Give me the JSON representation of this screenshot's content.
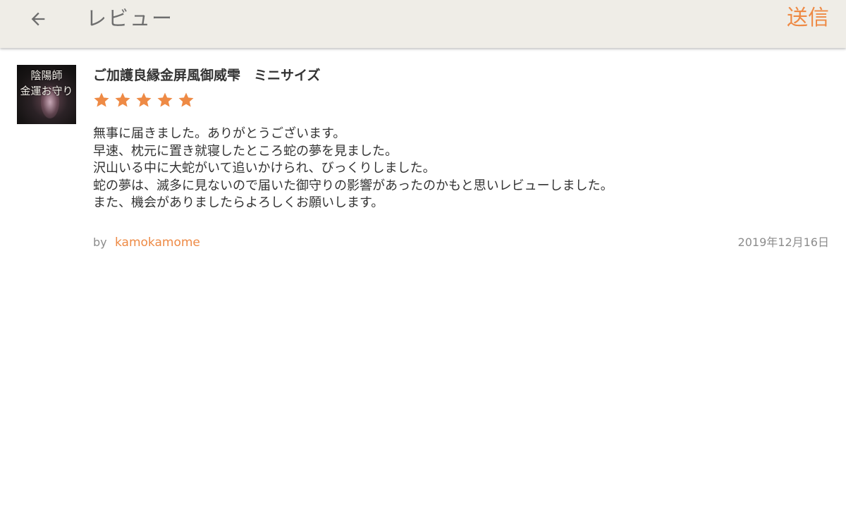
{
  "appbar": {
    "title": "レビュー",
    "send_label": "送信",
    "back_icon": "arrow-left-icon",
    "accent_color": "#ee8a45",
    "background_color": "#efede7"
  },
  "review": {
    "thumbnail": {
      "line1": "陰陽師",
      "line2": "金運お守り"
    },
    "product_title": "ご加護良縁金屏風御威雫　ミニサイズ",
    "rating": 5,
    "rating_max": 5,
    "star_color": "#ee8a45",
    "body_lines": [
      "無事に届きました。ありがとうございます。",
      "早速、枕元に置き就寝したところ蛇の夢を見ました。",
      "沢山いる中に大蛇がいて追いかけられ、びっくりしました。",
      "蛇の夢は、滅多に見ないので届いた御守りの影響があったのかもと思いレビューしました。",
      "また、機会がありましたらよろしくお願いします。"
    ],
    "by_label": "by",
    "author": "kamokamome",
    "date": "2019年12月16日"
  }
}
